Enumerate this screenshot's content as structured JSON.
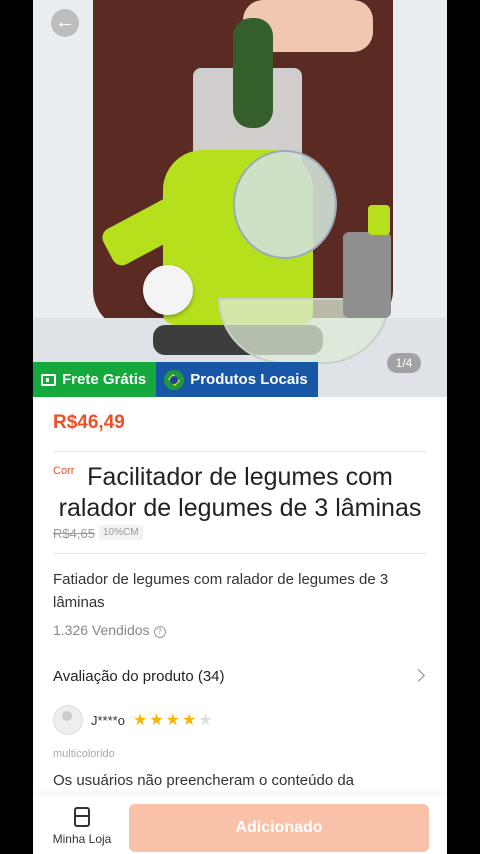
{
  "hero": {
    "counter": "1/4",
    "back_icon": "arrow-left-icon"
  },
  "badges": {
    "free_shipping": "Frete Grátis",
    "local_products": "Produtos Locais"
  },
  "product": {
    "price": "R$46,49",
    "title_prefix": "Corr",
    "title": "Facilitador de legumes com ralador de legumes de 3 lâminas",
    "old_price": "R$4,65",
    "discount_tag": "10%CM",
    "description": "Fatiador de legumes com ralador de legumes de 3 lâminas",
    "sold": "1.326 Vendidos",
    "sold_info_glyph": "?"
  },
  "reviews": {
    "header": "Avaliação do produto (34)",
    "reviewer_name": "J****o",
    "rating": 4,
    "rating_max": 5,
    "variant": "multicolorido",
    "text": "Os usuários não preencheram o conteúdo da"
  },
  "bottom_bar": {
    "store_label": "Minha Loja",
    "add_button": "Adicionado"
  },
  "colors": {
    "accent": "#f04e23",
    "free_shipping_bg": "#15a83c",
    "local_bg": "#1757a6",
    "button_disabled": "#f8c1a8",
    "star": "#f7b500"
  }
}
